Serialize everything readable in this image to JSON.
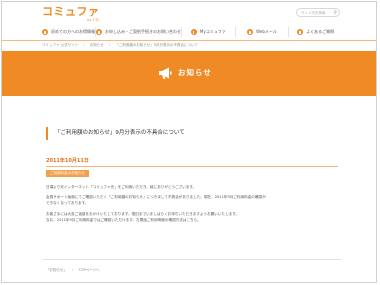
{
  "header": {
    "logo": "コミュファ",
    "logo_sub": "by CTC",
    "search_placeholder": "サイト内を検索"
  },
  "nav": [
    {
      "label": "初めての方へのお得情報"
    },
    {
      "label": "お申し込み・ご契約手続きのお問い合わせ"
    },
    {
      "label": "Myコミュファ"
    },
    {
      "label": "Webメール"
    },
    {
      "label": "よくあるご質問"
    }
  ],
  "breadcrumb": [
    "コミュファ 公式サイト",
    "お知らせ",
    "「ご利用額のお知らせ」9月分表示の不具合について"
  ],
  "banner": {
    "title": "お知らせ"
  },
  "article": {
    "title": "「ご利用額のお知らせ」9月分表示の不具合について",
    "date": "2011年10月11日",
    "category": "ご利用料金のお知らせ",
    "paragraphs": [
      "日頃より光インターネット「コミュファ光」をご利用いただき、誠にありがとうございます。",
      "会員サポート画面にてご確認いただく「ご利用額のお知らせ」につきまして不具合がありました。現在、2011年9月ご利用料金の確認が",
      "できなくなっております。",
      "",
      "お客さまには大変ご迷惑をおかけいたしております。復旧までいましばらくお待ちいただきますようお願いいたします。",
      "なお、2011年9月ご利用料金ではご確認いただけます。左電話ご利用明細の確認方法はこちら。"
    ]
  },
  "footer": {
    "crumbs": [
      "「お知らせ」",
      "TOPページへ"
    ]
  },
  "colors": {
    "brand": "#f08a24",
    "accent": "#e0731a"
  }
}
